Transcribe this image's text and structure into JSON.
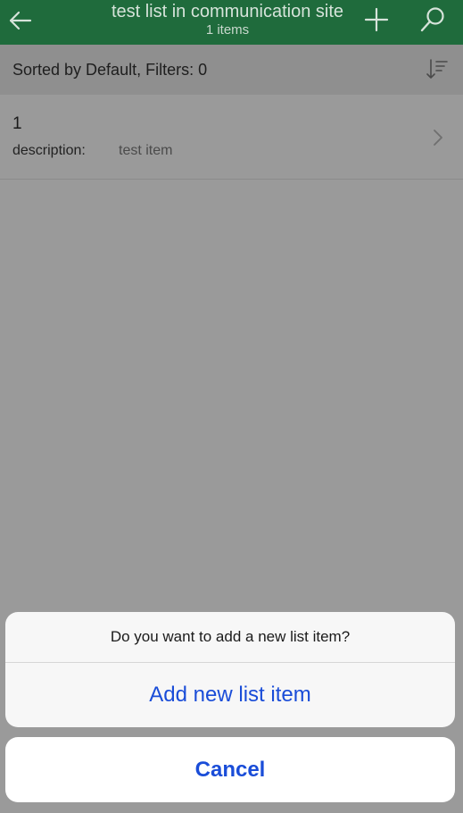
{
  "header": {
    "title": "test list in communication site",
    "subtitle": "1 items",
    "back_icon": "back-arrow-icon",
    "add_icon": "plus-icon",
    "search_icon": "search-icon",
    "color": "#1f6b3c"
  },
  "sortbar": {
    "label": "Sorted by Default, Filters: 0",
    "icon": "sort-icon"
  },
  "list": {
    "items": [
      {
        "title": "1",
        "field_label": "description:",
        "field_value": "test item"
      }
    ]
  },
  "action_sheet": {
    "question": "Do you want to add a new list item?",
    "primary_label": "Add new list item",
    "cancel_label": "Cancel",
    "accent": "#1a4dd8"
  }
}
